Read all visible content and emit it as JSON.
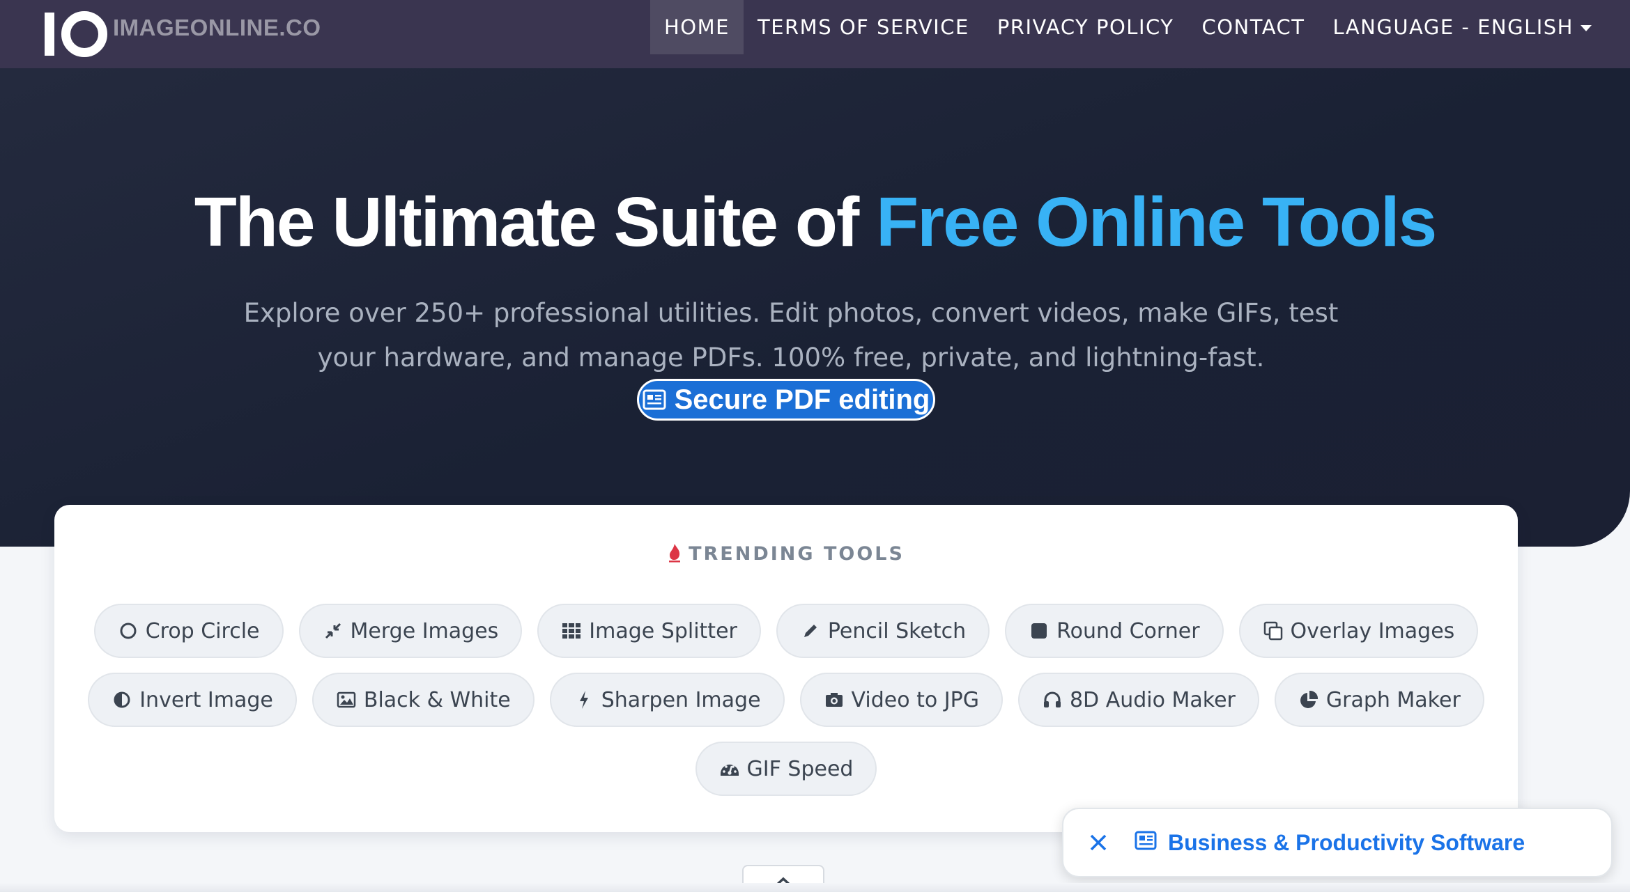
{
  "brand": {
    "mark_letters": "IO",
    "name": "IMAGEONLINE.CO"
  },
  "nav": {
    "items": [
      {
        "label": "HOME",
        "active": true
      },
      {
        "label": "TERMS OF SERVICE",
        "active": false
      },
      {
        "label": "PRIVACY POLICY",
        "active": false
      },
      {
        "label": "CONTACT",
        "active": false
      },
      {
        "label": "LANGUAGE - ENGLISH",
        "active": false,
        "dropdown": true
      }
    ]
  },
  "hero": {
    "title_main": "The Ultimate Suite of ",
    "title_accent": "Free Online Tools",
    "subtitle": "Explore over 250+ professional utilities. Edit photos, convert videos, make GIFs, test your hardware, and manage PDFs. 100% free, private, and lightning-fast.",
    "badge_label": "Secure PDF editing",
    "badge_icon": "newspaper-icon"
  },
  "trending": {
    "heading": "TRENDING TOOLS",
    "heading_icon": "fire-icon",
    "rows": [
      [
        {
          "label": "Crop Circle",
          "icon": "circle-icon"
        },
        {
          "label": "Merge Images",
          "icon": "compress-arrows-icon"
        },
        {
          "label": "Image Splitter",
          "icon": "grid-icon"
        },
        {
          "label": "Pencil Sketch",
          "icon": "pencil-icon"
        },
        {
          "label": "Round Corner",
          "icon": "rounded-square-icon"
        },
        {
          "label": "Overlay Images",
          "icon": "clone-icon"
        }
      ],
      [
        {
          "label": "Invert Image",
          "icon": "half-circle-icon"
        },
        {
          "label": "Black & White",
          "icon": "image-icon"
        },
        {
          "label": "Sharpen Image",
          "icon": "bolt-icon"
        },
        {
          "label": "Video to JPG",
          "icon": "camera-icon"
        },
        {
          "label": "8D Audio Maker",
          "icon": "headphones-icon"
        },
        {
          "label": "Graph Maker",
          "icon": "pie-chart-icon"
        }
      ],
      [
        {
          "label": "GIF Speed",
          "icon": "gauge-icon"
        }
      ]
    ]
  },
  "promo": {
    "label": "Business & Productivity Software",
    "icon": "newspaper-icon",
    "close_icon": "close-icon"
  },
  "scroll_up": {
    "icon": "chevron-up-icon"
  },
  "colors": {
    "navbar_bg": "#3a3550",
    "hero_bg": "#1b2134",
    "accent_blue": "#38b2f5",
    "badge_blue": "#1b6fd6",
    "link_blue": "#1a73e8",
    "chip_bg": "#eef1f5",
    "fire_red": "#dc3545"
  }
}
